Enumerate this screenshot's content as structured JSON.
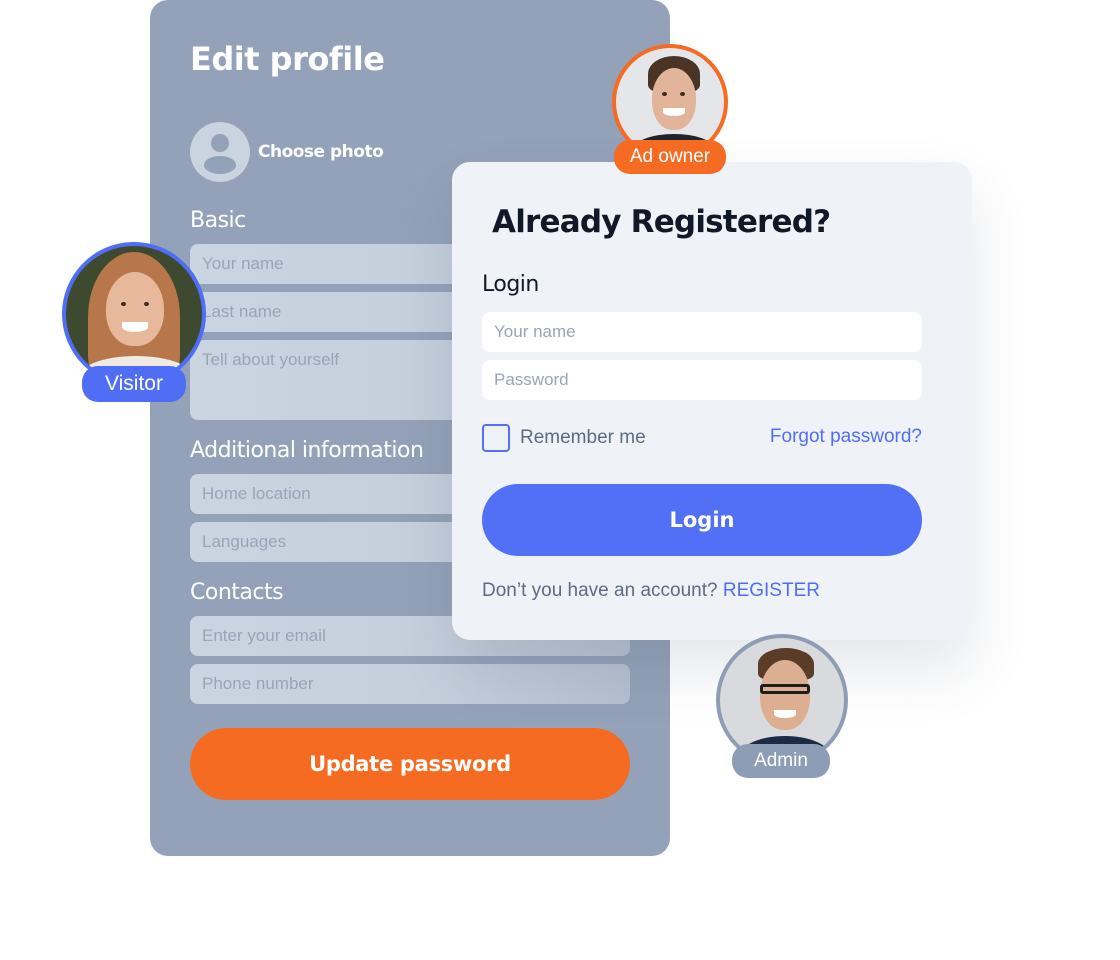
{
  "edit_profile": {
    "title": "Edit profile",
    "choose_photo": "Choose photo",
    "sections": {
      "basic": "Basic",
      "additional": "Additional information",
      "contacts": "Contacts"
    },
    "fields": {
      "your_name": "Your name",
      "last_name": "Last name",
      "about": "Tell about yourself",
      "home_location": "Home location",
      "languages": "Languages",
      "email": "Enter your email",
      "phone": "Phone number"
    },
    "update_button": "Update password"
  },
  "login": {
    "title": "Already Registered?",
    "label": "Login",
    "name_placeholder": "Your name",
    "password_placeholder": "Password",
    "remember_me": "Remember me",
    "remember_checked": false,
    "forgot_password": "Forgot password?",
    "login_button": "Login",
    "no_account": "Don’t you have an account?",
    "register": "REGISTER"
  },
  "avatars": {
    "visitor": {
      "badge": "Visitor",
      "color": "#4f6ef5"
    },
    "ad_owner": {
      "badge": "Ad owner",
      "color": "#f56b22"
    },
    "admin": {
      "badge": "Admin",
      "color": "#8d9db5"
    }
  },
  "colors": {
    "primary": "#5270f6",
    "accent": "#f56b22",
    "card_bg": "#93a2b8",
    "login_bg": "#eff3f8"
  }
}
